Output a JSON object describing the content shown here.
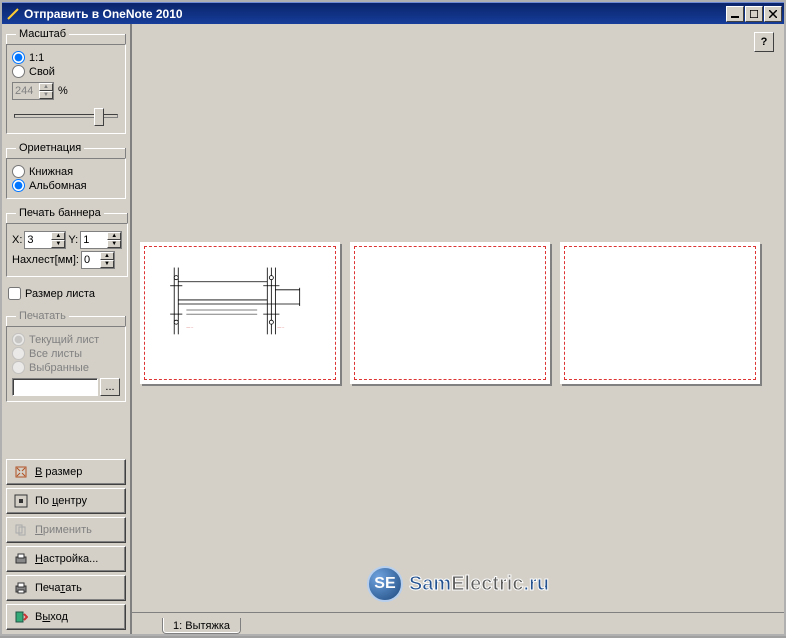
{
  "window": {
    "title": "Отправить в OneNote 2010"
  },
  "scale": {
    "legend": "Масштаб",
    "opt_1_1": "1:1",
    "opt_custom": "Свой",
    "value": "244",
    "percent": "%"
  },
  "orientation": {
    "legend": "Ориетнация",
    "portrait": "Книжная",
    "landscape": "Альбомная"
  },
  "banner": {
    "legend": "Печать баннера",
    "x_label": "X:",
    "x_value": "3",
    "y_label": "Y:",
    "y_value": "1",
    "overlap_label": "Нахлест[мм]:",
    "overlap_value": "0"
  },
  "page_size_checkbox": "Размер листа",
  "print_scope": {
    "legend": "Печатать",
    "current": "Текущий лист",
    "all": "Все листы",
    "selected": "Выбранные",
    "browse": "..."
  },
  "buttons": {
    "fit": "В размер",
    "center": "По центру",
    "apply": "Применить",
    "settings": "Настройка...",
    "print": "Печатать",
    "exit": "Выход"
  },
  "tab": {
    "label": "1: Вытяжка"
  },
  "help": "?",
  "watermark": {
    "badge": "SE",
    "p1": "Sam",
    "p2": "Electric",
    "p3": ".ru"
  },
  "winbuttons": {
    "min": "_",
    "max": "□",
    "close": "✕"
  }
}
